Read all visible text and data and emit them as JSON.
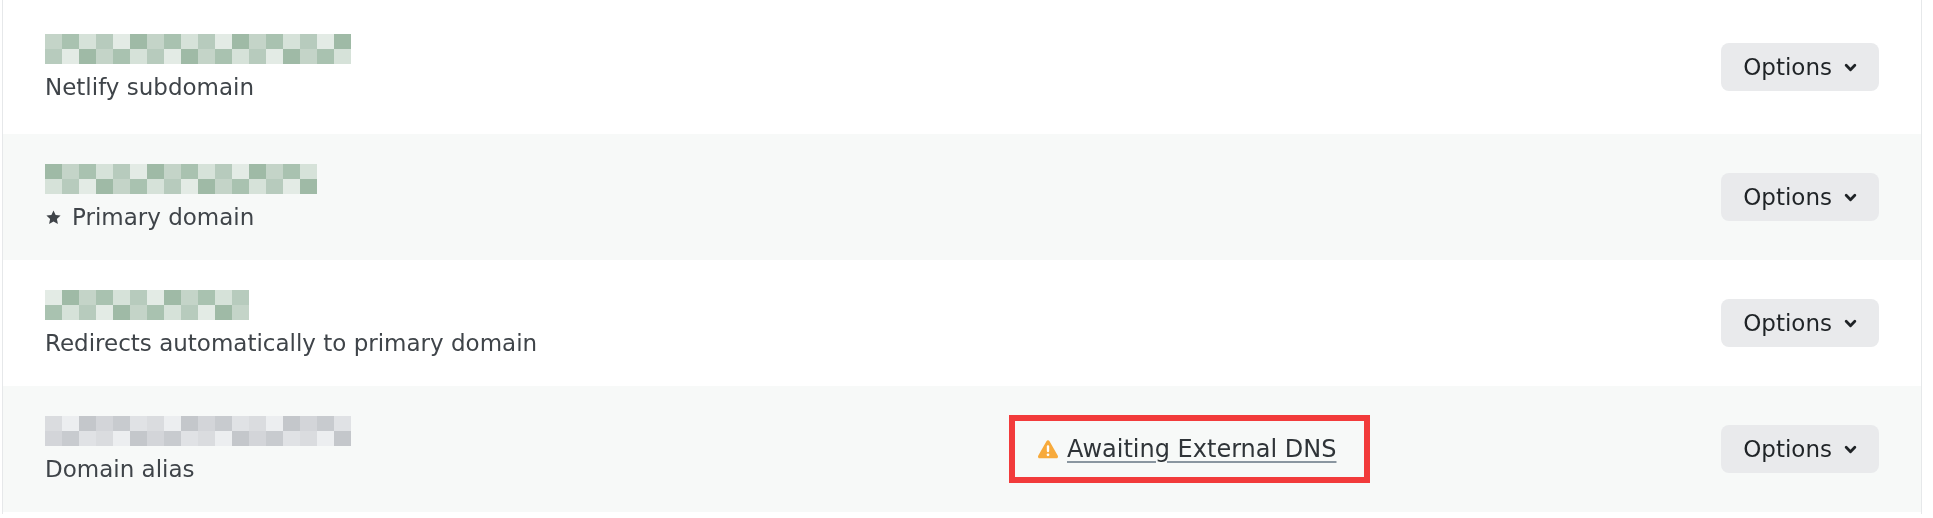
{
  "domains": [
    {
      "description": "Netlify subdomain",
      "primary": false,
      "button": "Options"
    },
    {
      "description": "Primary domain",
      "primary": true,
      "button": "Options"
    },
    {
      "description": "Redirects automatically to primary domain",
      "primary": false,
      "button": "Options"
    },
    {
      "description": "Domain alias",
      "primary": false,
      "button": "Options",
      "status": {
        "kind": "warning",
        "text": "Awaiting External DNS",
        "highlighted": true
      }
    }
  ]
}
